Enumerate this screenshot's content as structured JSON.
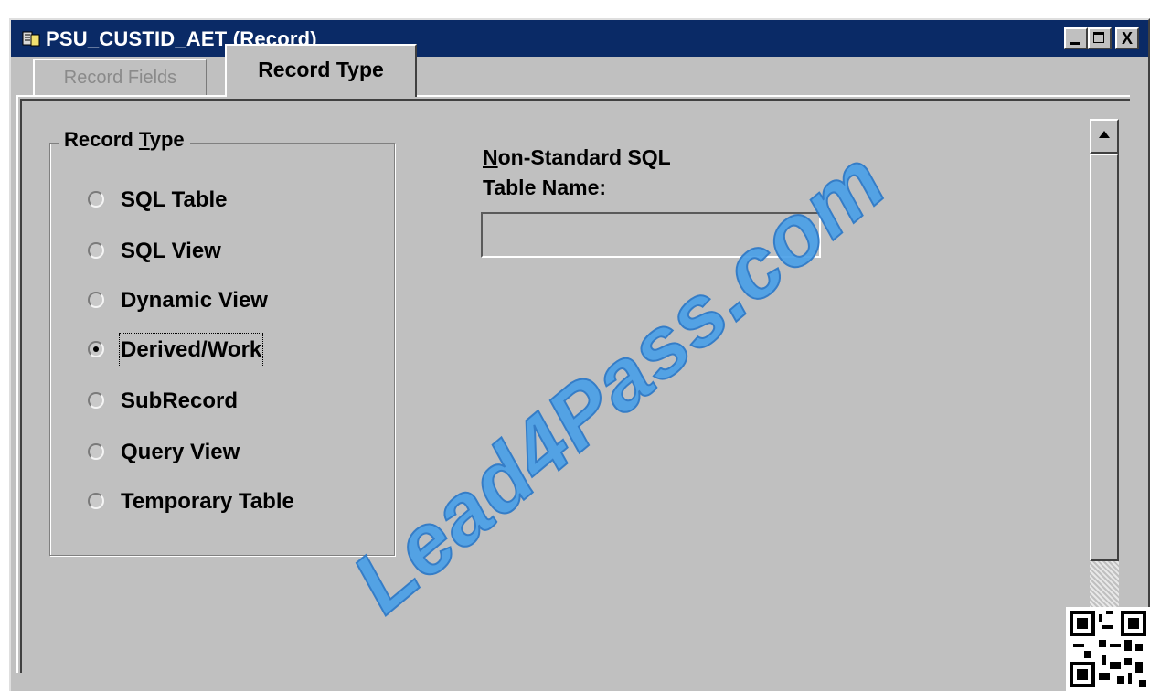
{
  "window": {
    "title": "PSU_CUSTID_AET (Record)",
    "buttons": {
      "minimize": "_",
      "maximize": "□",
      "close": "X"
    }
  },
  "tabs": [
    {
      "label": "Record Fields",
      "active": false
    },
    {
      "label": "Record Type",
      "active": true
    }
  ],
  "record_type_group": {
    "legend_prefix": "Record ",
    "legend_accel": "T",
    "legend_suffix": "ype",
    "options": [
      {
        "label": "SQL Table",
        "selected": false
      },
      {
        "label": "SQL View",
        "selected": false
      },
      {
        "label": "Dynamic View",
        "selected": false
      },
      {
        "label": "Derived/Work",
        "selected": true
      },
      {
        "label": "SubRecord",
        "selected": false
      },
      {
        "label": "Query View",
        "selected": false
      },
      {
        "label": "Temporary Table",
        "selected": false
      }
    ]
  },
  "non_standard_sql": {
    "label_accel": "N",
    "label_line1_rest": "on-Standard SQL",
    "label_line2": "Table Name:",
    "value": ""
  },
  "watermark": "Lead4Pass.com",
  "colors": {
    "titlebar": "#0a2a66",
    "face": "#c0c0c0",
    "watermark": "#4aa0e8"
  }
}
